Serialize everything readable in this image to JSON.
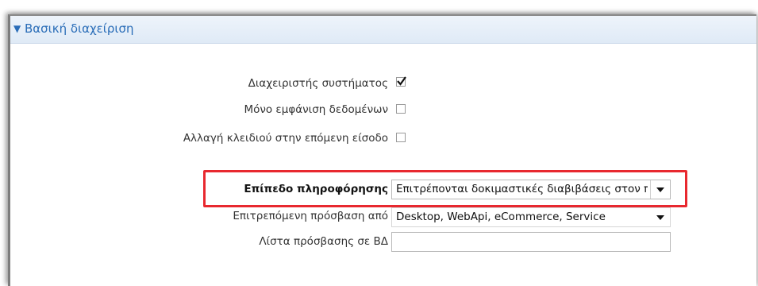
{
  "section": {
    "title": "Βασική διαχείριση",
    "collapse_icon": "triangle-down-icon"
  },
  "fields": {
    "system_admin": {
      "label": "Διαχειριστής συστήματος",
      "checked": true
    },
    "read_only": {
      "label": "Μόνο εμφάνιση δεδομένων",
      "checked": false
    },
    "change_password": {
      "label": "Αλλαγή κλειδιού στην επόμενη είσοδο",
      "checked": false
    },
    "info_level": {
      "label": "Επίπεδο πληροφόρησης",
      "value": "Επιτρέπονται δοκιμαστικές διαβιβάσεις στον π"
    },
    "allowed_access": {
      "label": "Επιτρεπόμενη πρόσβαση από",
      "value": "Desktop, WebApi, eCommerce, Service"
    },
    "db_access_list": {
      "label": "Λίστα πρόσβασης σε ΒΔ",
      "value": ""
    }
  },
  "colors": {
    "accent": "#2a6db8",
    "highlight": "#e8282f"
  }
}
